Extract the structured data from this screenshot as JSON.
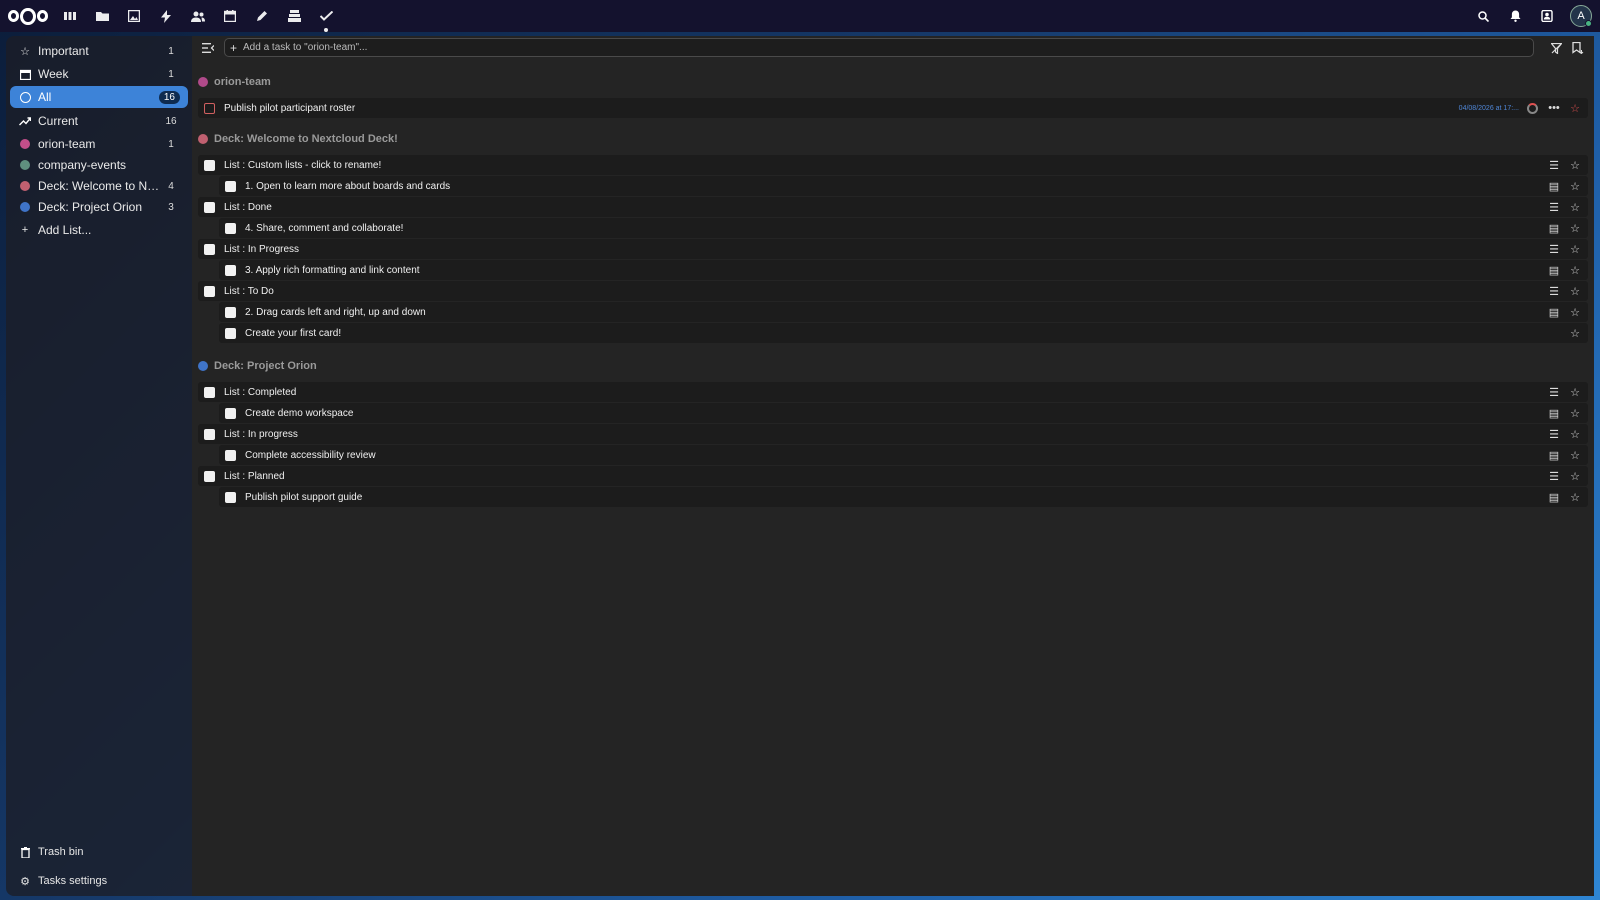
{
  "topbar": {
    "apps": [
      {
        "name": "dashboard-icon",
        "glyph": "▮▮▮"
      },
      {
        "name": "files-icon",
        "glyph": "▬"
      },
      {
        "name": "photos-icon",
        "glyph": "▣"
      },
      {
        "name": "activity-icon",
        "glyph": "⚡"
      },
      {
        "name": "contacts-icon",
        "glyph": "👥"
      },
      {
        "name": "calendar-icon",
        "glyph": "▦"
      },
      {
        "name": "notes-icon",
        "glyph": "✎"
      },
      {
        "name": "deck-icon",
        "glyph": "≣"
      },
      {
        "name": "tasks-icon",
        "glyph": "✔"
      }
    ],
    "avatar_letter": "A"
  },
  "sidebar": {
    "items": [
      {
        "label": "Important",
        "count": "1",
        "icon": "star-icon"
      },
      {
        "label": "Week",
        "count": "1",
        "icon": "calendar-week-icon"
      },
      {
        "label": "All",
        "count": "16",
        "icon": "circle-icon"
      },
      {
        "label": "Current",
        "count": "16",
        "icon": "trending-up-icon"
      },
      {
        "label": "orion-team",
        "count": "1",
        "color": "#c24e8a"
      },
      {
        "label": "company-events",
        "count": "",
        "color": "#5f8f7f"
      },
      {
        "label": "Deck: Welcome to Nextclou...",
        "count": "4",
        "color": "#c06070"
      },
      {
        "label": "Deck: Project Orion",
        "count": "3",
        "color": "#3f74c8"
      }
    ],
    "add_list": "Add List...",
    "trash": "Trash bin",
    "settings": "Tasks settings"
  },
  "main": {
    "add_placeholder": "Add a task to \"orion-team\"...",
    "groups": [
      {
        "name": "orion-team",
        "color": "#b04a8a"
      },
      {
        "name": "Deck: Welcome to Nextcloud Deck!",
        "color": "#c06070"
      },
      {
        "name": "Deck: Project Orion",
        "color": "#3f74c8"
      }
    ],
    "orion_task": {
      "title": "Publish pilot participant roster",
      "due": "04/08/2026 at 17:..."
    },
    "welcome_tasks": [
      "List : Custom lists - click to rename!",
      "1. Open to learn more about boards and cards",
      "List : Done",
      "4. Share, comment and collaborate!",
      "List : In Progress",
      "3. Apply rich formatting and link content",
      "List : To Do",
      "2. Drag cards left and right, up and down",
      "Create your first card!"
    ],
    "orion_tasks": [
      "List : Completed",
      "Create demo workspace",
      "List : In progress",
      "Complete accessibility review",
      "List : Planned",
      "Publish pilot support guide"
    ]
  },
  "colors": {
    "accent": "#3d83d8",
    "background": "#242424",
    "sidebar": "#1c1e26",
    "topbar": "#14122e"
  }
}
